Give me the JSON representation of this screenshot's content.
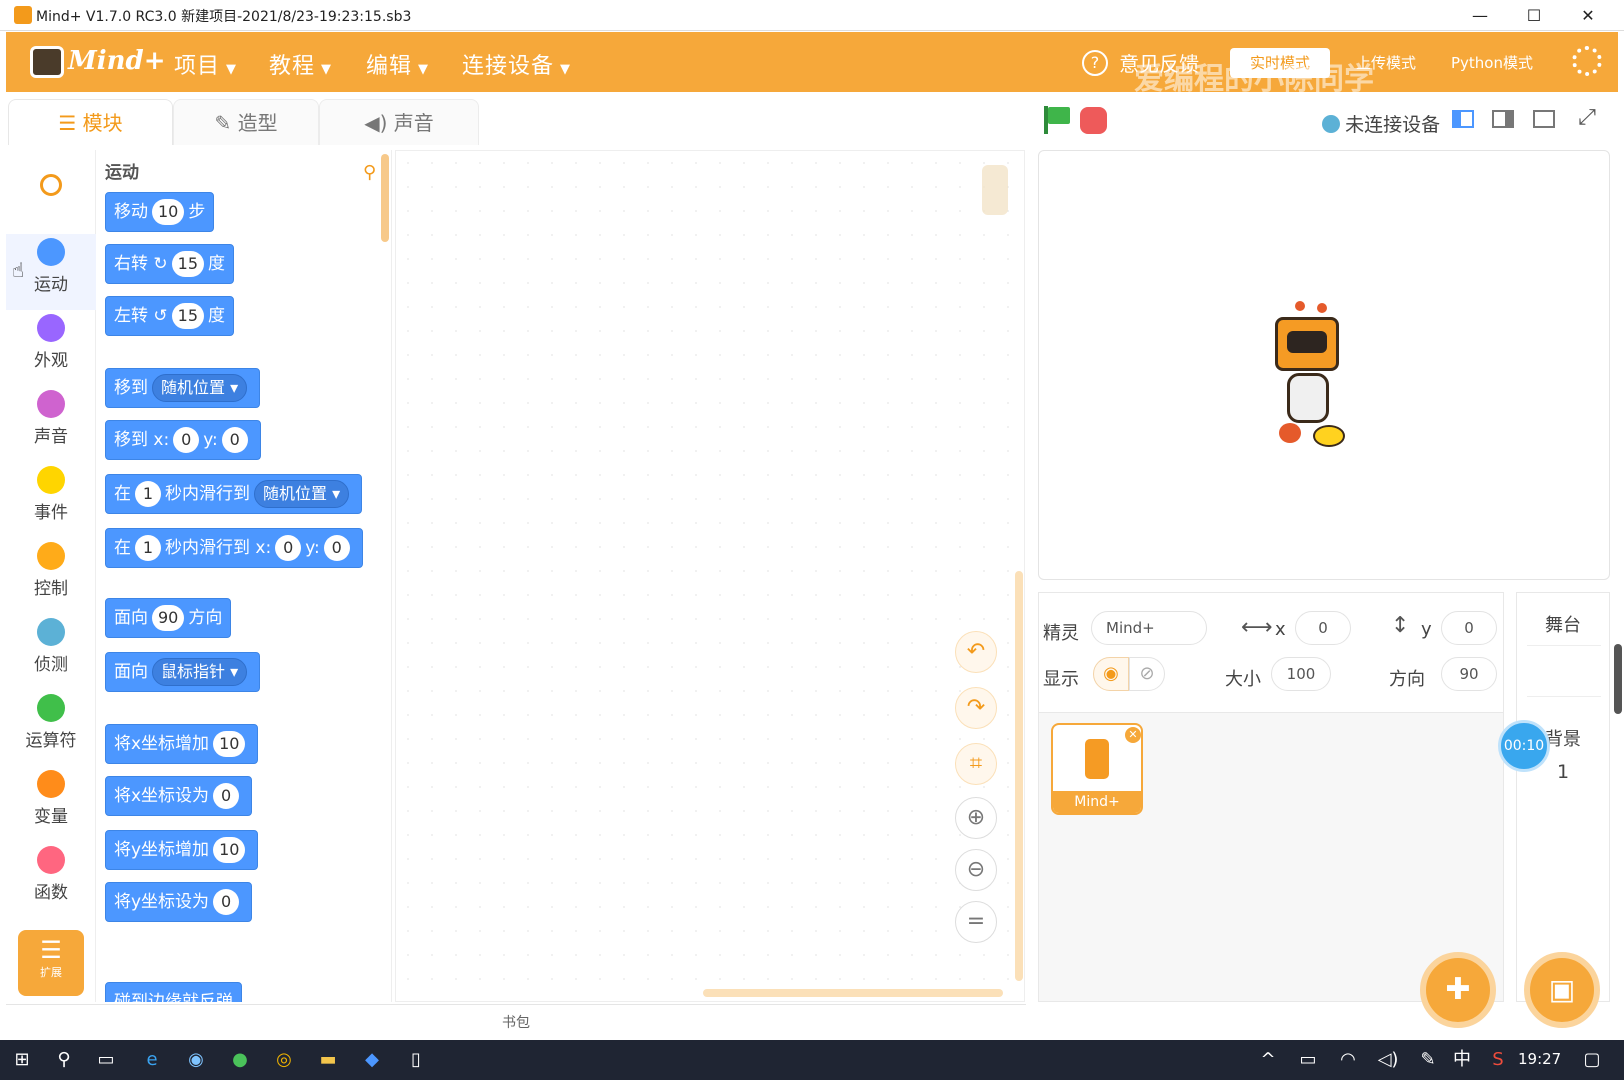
{
  "titlebar": {
    "title": "Mind+ V1.7.0 RC3.0   新建项目-2021/8/23-19:23:15.sb3",
    "minimize": "—",
    "maximize": "☐",
    "close": "✕"
  },
  "menubar": {
    "logo": "Mind+",
    "items": [
      "项目",
      "教程",
      "编辑",
      "连接设备"
    ],
    "feedback": "意见反馈",
    "modes": [
      "实时模式",
      "上传模式",
      "Python模式"
    ],
    "watermark": "爱编程的小陈同学",
    "caret": "▼"
  },
  "tabs": [
    {
      "label": "模块",
      "icon": "blocks-icon"
    },
    {
      "label": "造型",
      "icon": "brush-icon"
    },
    {
      "label": "声音",
      "icon": "speaker-icon"
    }
  ],
  "device": {
    "status": "未连接设备"
  },
  "categories": [
    {
      "label": "运动",
      "color": "#4c97ff"
    },
    {
      "label": "外观",
      "color": "#9966ff"
    },
    {
      "label": "声音",
      "color": "#cf63cf"
    },
    {
      "label": "事件",
      "color": "#ffd500"
    },
    {
      "label": "控制",
      "color": "#ffab19"
    },
    {
      "label": "侦测",
      "color": "#5cb1d6"
    },
    {
      "label": "运算符",
      "color": "#40bf4a"
    },
    {
      "label": "变量",
      "color": "#ff8c1a"
    },
    {
      "label": "函数",
      "color": "#ff6680"
    }
  ],
  "extension": {
    "label": "扩展"
  },
  "palette": {
    "section": "运动",
    "blocks": {
      "move": {
        "a": "移动",
        "v": "10",
        "b": "步"
      },
      "turn_right": {
        "a": "右转",
        "v": "15",
        "b": "度"
      },
      "turn_left": {
        "a": "左转",
        "v": "15",
        "b": "度"
      },
      "goto": {
        "a": "移到",
        "dd": "随机位置"
      },
      "goto_xy": {
        "a": "移到 x:",
        "x": "0",
        "y_label": "y:",
        "y": "0"
      },
      "glide": {
        "a": "在",
        "v": "1",
        "b": "秒内滑行到",
        "dd": "随机位置"
      },
      "glide_xy": {
        "a": "在",
        "v": "1",
        "b": "秒内滑行到 x:",
        "x": "0",
        "y_label": "y:",
        "y": "0"
      },
      "point_dir": {
        "a": "面向",
        "v": "90",
        "b": "方向"
      },
      "point_towards": {
        "a": "面向",
        "dd": "鼠标指针"
      },
      "change_x": {
        "a": "将x坐标增加",
        "v": "10"
      },
      "set_x": {
        "a": "将x坐标设为",
        "v": "0"
      },
      "change_y": {
        "a": "将y坐标增加",
        "v": "10"
      },
      "set_y": {
        "a": "将y坐标设为",
        "v": "0"
      },
      "bounce": {
        "a": "碰到边缘就反弹"
      }
    }
  },
  "backpack": {
    "label": "书包"
  },
  "sprite_info": {
    "sprite_label": "精灵",
    "sprite_name": "Mind+",
    "x_label": "x",
    "x": "0",
    "y_label": "y",
    "y": "0",
    "show_label": "显示",
    "size_label": "大小",
    "size": "100",
    "direction_label": "方向",
    "direction": "90"
  },
  "sprites": [
    {
      "name": "Mind+"
    }
  ],
  "stage_pane": {
    "title": "舞台",
    "backdrop_label": "背景",
    "backdrop_count": "1"
  },
  "timer": {
    "value": "00:10"
  },
  "taskbar": {
    "ime": "中",
    "clock": "19:27"
  }
}
